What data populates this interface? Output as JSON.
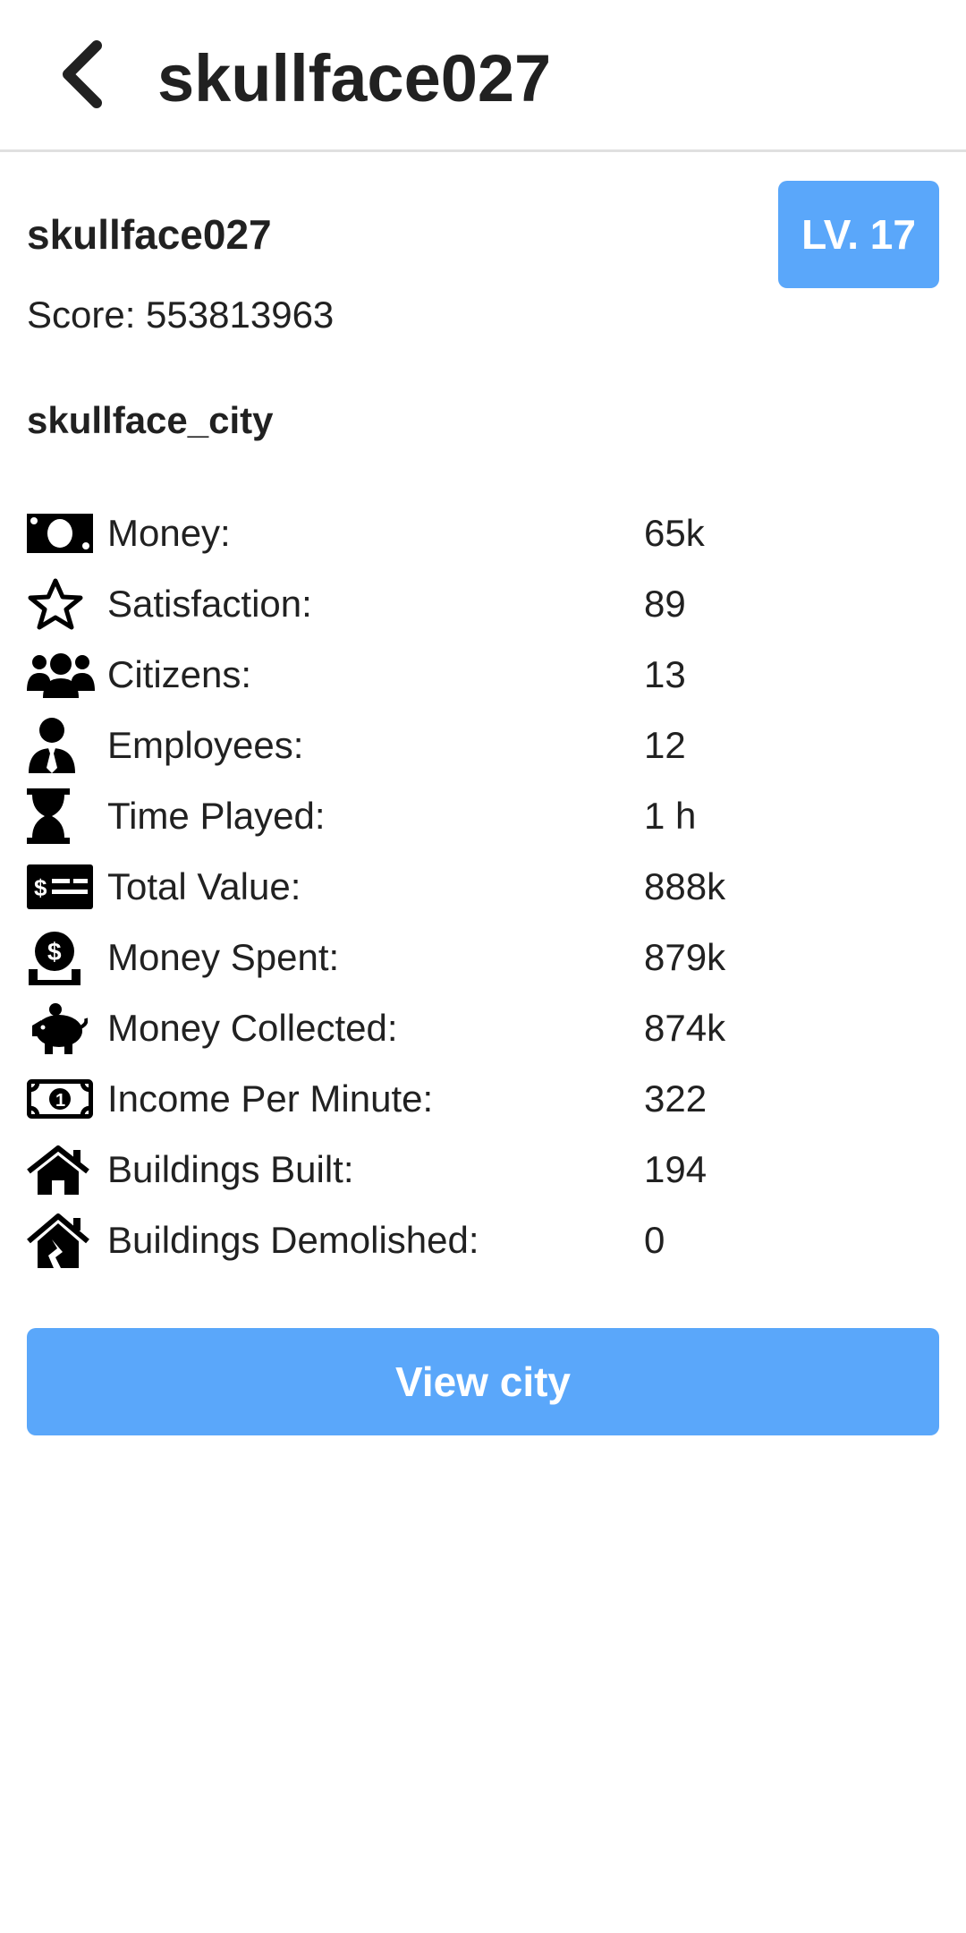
{
  "appbar": {
    "back_icon": "chevron-left-icon",
    "title": "skullface027"
  },
  "profile": {
    "username": "skullface027",
    "level_label": "LV. 17",
    "score_label": "Score: 553813963",
    "city_name": "skullface_city"
  },
  "stats": [
    {
      "icon": "money-bill-icon",
      "label": "Money:",
      "value": "65k"
    },
    {
      "icon": "star-icon",
      "label": "Satisfaction:",
      "value": "89"
    },
    {
      "icon": "users-icon",
      "label": "Citizens:",
      "value": "13"
    },
    {
      "icon": "employee-icon",
      "label": "Employees:",
      "value": "12"
    },
    {
      "icon": "hourglass-icon",
      "label": "Time Played:",
      "value": "1 h"
    },
    {
      "icon": "money-check-icon",
      "label": "Total Value:",
      "value": "888k"
    },
    {
      "icon": "hand-coin-icon",
      "label": "Money Spent:",
      "value": "879k"
    },
    {
      "icon": "piggy-bank-icon",
      "label": "Money Collected:",
      "value": "874k"
    },
    {
      "icon": "money-bill-one-icon",
      "label": "Income Per Minute:",
      "value": "322"
    },
    {
      "icon": "house-icon",
      "label": "Buildings Built:",
      "value": "194"
    },
    {
      "icon": "house-damage-icon",
      "label": "Buildings Demolished:",
      "value": "0"
    }
  ],
  "actions": {
    "view_city_label": "View city"
  },
  "colors": {
    "accent": "#5aa7fa",
    "text": "#212121",
    "divider": "#e0e0e0"
  }
}
